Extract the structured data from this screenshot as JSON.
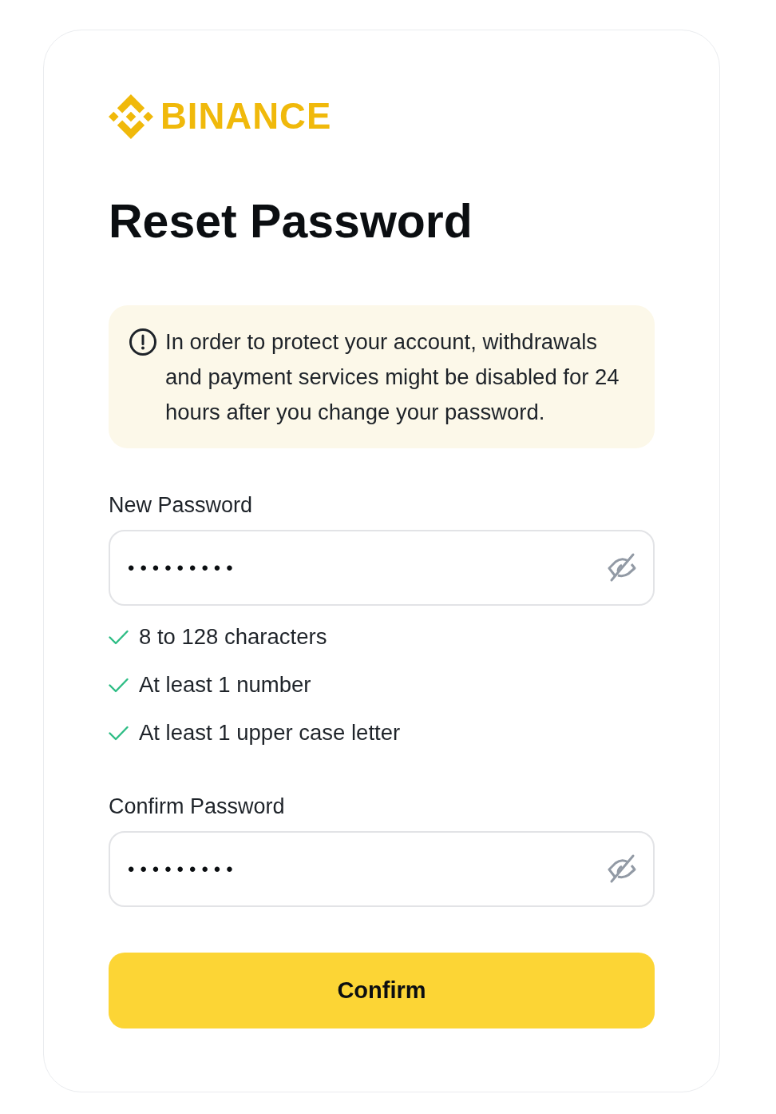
{
  "brand": {
    "name": "BINANCE"
  },
  "title": "Reset Password",
  "notice": {
    "text": "In order to protect your account, withdrawals and payment services might be disabled for 24 hours after you change your password."
  },
  "fields": [
    {
      "label": "New Password",
      "value": "•••••••••",
      "password_visible": false,
      "requirements": [
        {
          "text": "8 to 128 characters",
          "met": true
        },
        {
          "text": "At least 1 number",
          "met": true
        },
        {
          "text": "At least 1 upper case letter",
          "met": true
        }
      ]
    },
    {
      "label": "Confirm Password",
      "value": "•••••••••",
      "password_visible": false
    }
  ],
  "button": {
    "label": "Confirm"
  }
}
